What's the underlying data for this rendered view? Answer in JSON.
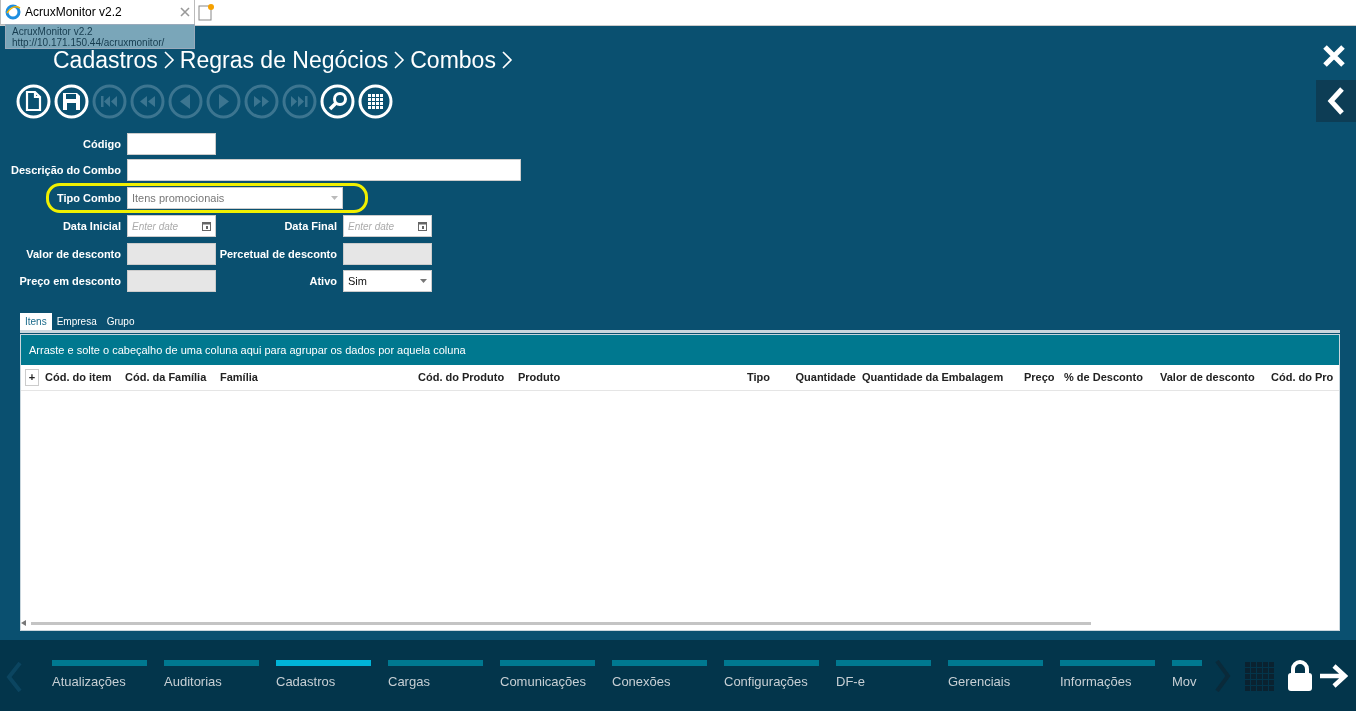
{
  "browser_tab": {
    "title": "AcruxMonitor v2.2"
  },
  "tooltip": {
    "title": "AcruxMonitor v2.2",
    "url": "http://10.171.150.44/acruxmonitor/"
  },
  "breadcrumb": [
    "Cadastros",
    "Regras de Negócios",
    "Combos"
  ],
  "toolbar": [
    {
      "kind": "new",
      "disabled": false
    },
    {
      "kind": "save",
      "disabled": false
    },
    {
      "kind": "first",
      "disabled": true
    },
    {
      "kind": "rewind",
      "disabled": true
    },
    {
      "kind": "prev",
      "disabled": true
    },
    {
      "kind": "next",
      "disabled": true
    },
    {
      "kind": "forward",
      "disabled": true
    },
    {
      "kind": "last",
      "disabled": true
    },
    {
      "kind": "search",
      "disabled": false
    },
    {
      "kind": "grid",
      "disabled": false
    }
  ],
  "form": {
    "codigo": {
      "label": "Código"
    },
    "descricao": {
      "label": "Descrição do Combo"
    },
    "tipo": {
      "label": "Tipo Combo",
      "value": "Itens promocionais",
      "highlighted": true
    },
    "data_inicial": {
      "label": "Data Inicial",
      "placeholder": "Enter date"
    },
    "data_final": {
      "label": "Data Final",
      "placeholder": "Enter date"
    },
    "valor": {
      "label": "Valor de desconto"
    },
    "percentual": {
      "label": "Percetual de desconto"
    },
    "preco": {
      "label": "Preço em desconto"
    },
    "ativo": {
      "label": "Ativo",
      "value": "Sim"
    }
  },
  "tabs": [
    {
      "label": "Itens",
      "selected": true
    },
    {
      "label": "Empresa",
      "selected": false
    },
    {
      "label": "Grupo",
      "selected": false
    }
  ],
  "grid": {
    "group_hint": "Arraste e solte o cabeçalho de uma coluna aqui para agrupar os dados por aquela coluna",
    "expand": "+",
    "columns": [
      {
        "label": "Cód. do item"
      },
      {
        "label": "Cód. da Família"
      },
      {
        "label": "Família"
      },
      {
        "label": "Cód. do Produto"
      },
      {
        "label": "Produto"
      },
      {
        "label": "Tipo"
      },
      {
        "label": "Quantidade"
      },
      {
        "label": "Quantidade da Embalagem"
      },
      {
        "label": "Preço"
      },
      {
        "label": "% de Desconto"
      },
      {
        "label": "Valor de desconto"
      },
      {
        "label": "Cód. do Pro"
      }
    ]
  },
  "nav": [
    {
      "label": "Atualizações",
      "selected": false
    },
    {
      "label": "Auditorias",
      "selected": false
    },
    {
      "label": "Cadastros",
      "selected": true
    },
    {
      "label": "Cargas",
      "selected": false
    },
    {
      "label": "Comunicações",
      "selected": false
    },
    {
      "label": "Conexões",
      "selected": false
    },
    {
      "label": "Configurações",
      "selected": false
    },
    {
      "label": "DF-e",
      "selected": false
    },
    {
      "label": "Gerenciais",
      "selected": false
    },
    {
      "label": "Informações",
      "selected": false
    },
    {
      "label": "Mov",
      "selected": false
    }
  ]
}
